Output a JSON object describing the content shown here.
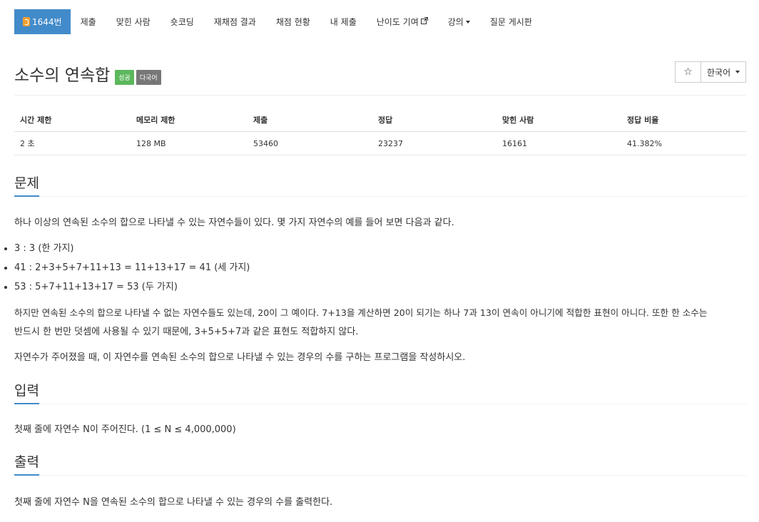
{
  "nav": {
    "items": [
      {
        "label": "1644번",
        "active": true
      },
      {
        "label": "제출"
      },
      {
        "label": "맞힌 사람"
      },
      {
        "label": "숏코딩"
      },
      {
        "label": "재채점 결과"
      },
      {
        "label": "채점 현황"
      },
      {
        "label": "내 제출"
      },
      {
        "label": "난이도 기여"
      },
      {
        "label": "강의"
      },
      {
        "label": "질문 게시판"
      }
    ]
  },
  "problem": {
    "title": "소수의 연속합",
    "labels": [
      "성공",
      "다국어"
    ],
    "star": "☆",
    "language": "한국어"
  },
  "info_table": {
    "headers": [
      "시간 제한",
      "메모리 제한",
      "제출",
      "정답",
      "맞힌 사람",
      "정답 비율"
    ],
    "row": [
      "2 초",
      "128 MB",
      "53460",
      "23237",
      "16161",
      "41.382%"
    ]
  },
  "sections": {
    "problem_heading": "문제",
    "problem_p1": "하나 이상의 연속된 소수의 합으로 나타낼 수 있는 자연수들이 있다. 몇 가지 자연수의 예를 들어 보면 다음과 같다.",
    "examples": [
      "3 : 3 (한 가지)",
      "41 : 2+3+5+7+11+13 = 11+13+17 = 41 (세 가지)",
      "53 : 5+7+11+13+17 = 53 (두 가지)"
    ],
    "problem_p2_line1": "하지만 연속된 소수의 합으로 나타낼 수 없는 자연수들도 있는데, 20이 그 예이다. 7+13을 계산하면 20이 되기는 하나 7과 13이 연속이 아니기에 적합한 표현이 아니다. 또한 한 소수는",
    "problem_p2_line2": "반드시 한 번만 덧셈에 사용될 수 있기 때문에, 3+5+5+7과 같은 표현도 적합하지 않다.",
    "problem_p3": "자연수가 주어졌을 때, 이 자연수를 연속된 소수의 합으로 나타낼 수 있는 경우의 수를 구하는 프로그램을 작성하시오.",
    "input_heading": "입력",
    "input_text": "첫째 줄에 자연수 N이 주어진다. (1 ≤ N ≤ 4,000,000)",
    "output_heading": "출력",
    "output_text": "첫째 줄에 자연수 N을 연속된 소수의 합으로 나타낼 수 있는 경우의 수를 출력한다."
  },
  "colors": {
    "nav_active": "#428bca",
    "label_success": "#5cb85c",
    "label_multi": "#777777",
    "tier": "#f0a030"
  }
}
